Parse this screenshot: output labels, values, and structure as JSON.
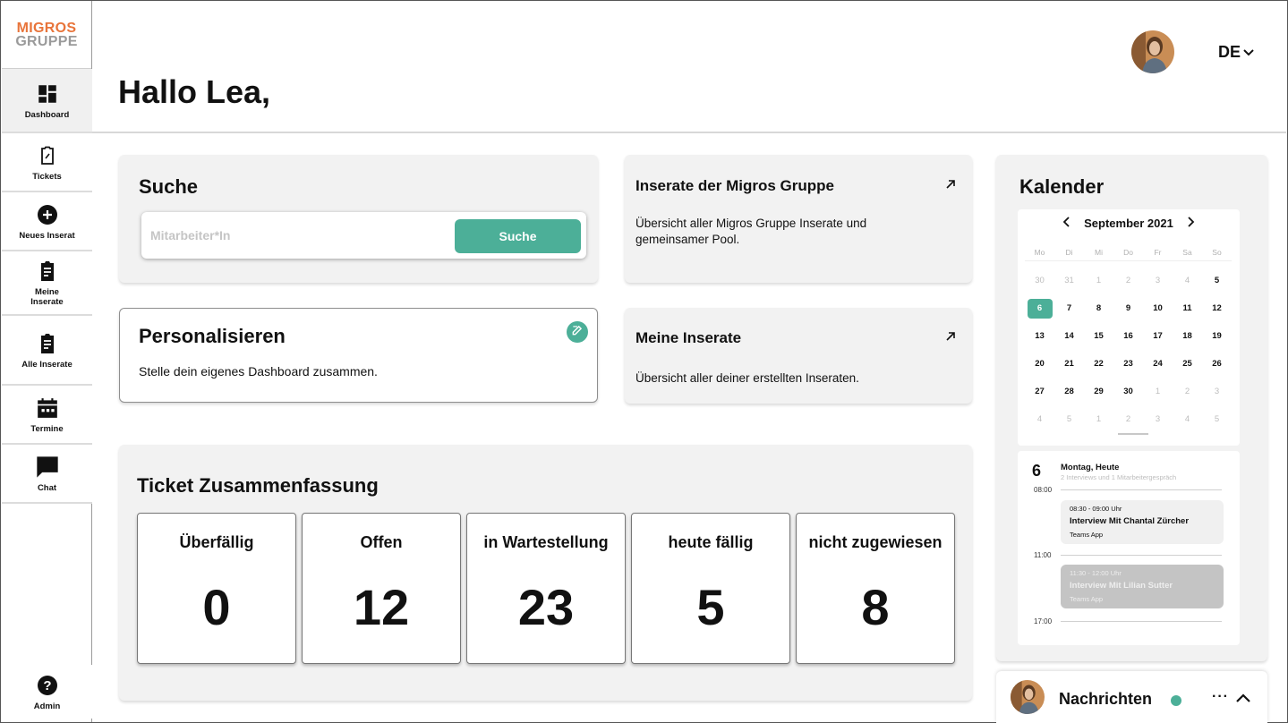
{
  "logo": {
    "line1": "MIGROS",
    "line2": "GRUPPE"
  },
  "sidebar": {
    "items": [
      {
        "label": "Dashboard",
        "icon": "dashboard-icon"
      },
      {
        "label": "Tickets",
        "icon": "ticket-clipboard-icon"
      },
      {
        "label": "Neues Inserat",
        "icon": "plus-circle-icon"
      },
      {
        "label": "Meine Inserate",
        "icon": "clipboard-list-icon"
      },
      {
        "label": "Alle Inserate",
        "icon": "clipboard-list-icon"
      },
      {
        "label": "Termine",
        "icon": "calendar-icon"
      },
      {
        "label": "Chat",
        "icon": "chat-bubble-icon"
      },
      {
        "label": "Admin",
        "icon": "help-circle-icon"
      }
    ]
  },
  "header": {
    "greeting": "Hallo Lea,",
    "language": "DE"
  },
  "search": {
    "title": "Suche",
    "placeholder": "Mitarbeiter*In",
    "button_label": "Suche"
  },
  "personalize": {
    "title": "Personalisieren",
    "text": "Stelle dein eigenes Dashboard zusammen."
  },
  "inserate_gruppe": {
    "title": "Inserate der Migros Gruppe",
    "text": "Übersicht aller Migros Gruppe Inserate und gemeinsamer Pool."
  },
  "meine_inserate": {
    "title": "Meine Inserate",
    "text": "Übersicht aller deiner erstellten Inseraten."
  },
  "tickets": {
    "title": "Ticket Zusammenfassung",
    "cards": [
      {
        "label": "Überfällig",
        "value": "0"
      },
      {
        "label": "Offen",
        "value": "12"
      },
      {
        "label": "in Wartestellung",
        "value": "23"
      },
      {
        "label": "heute fällig",
        "value": "5"
      },
      {
        "label": "nicht zugewiesen",
        "value": "8"
      }
    ]
  },
  "calendar": {
    "title": "Kalender",
    "month": "September 2021",
    "weekdays": [
      "Mo",
      "Di",
      "Mi",
      "Do",
      "Fr",
      "Sa",
      "So"
    ],
    "selected": "6",
    "weeks": [
      [
        [
          "30",
          1
        ],
        [
          "31",
          1
        ],
        [
          "1",
          1
        ],
        [
          "2",
          1
        ],
        [
          "3",
          1
        ],
        [
          "4",
          1
        ],
        [
          "5",
          0
        ]
      ],
      [
        [
          "6",
          0
        ],
        [
          "7",
          0
        ],
        [
          "8",
          0
        ],
        [
          "9",
          0
        ],
        [
          "10",
          0
        ],
        [
          "11",
          0
        ],
        [
          "12",
          0
        ]
      ],
      [
        [
          "13",
          0
        ],
        [
          "14",
          0
        ],
        [
          "15",
          0
        ],
        [
          "16",
          0
        ],
        [
          "17",
          0
        ],
        [
          "18",
          0
        ],
        [
          "19",
          0
        ]
      ],
      [
        [
          "20",
          0
        ],
        [
          "21",
          0
        ],
        [
          "22",
          0
        ],
        [
          "23",
          0
        ],
        [
          "24",
          0
        ],
        [
          "25",
          0
        ],
        [
          "26",
          0
        ]
      ],
      [
        [
          "27",
          0
        ],
        [
          "28",
          0
        ],
        [
          "29",
          0
        ],
        [
          "30",
          0
        ],
        [
          "1",
          1
        ],
        [
          "2",
          1
        ],
        [
          "3",
          1
        ]
      ],
      [
        [
          "4",
          1
        ],
        [
          "5",
          1
        ],
        [
          "1",
          1
        ],
        [
          "2",
          1
        ],
        [
          "3",
          1
        ],
        [
          "4",
          1
        ],
        [
          "5",
          1
        ]
      ]
    ],
    "day": {
      "number": "6",
      "title": "Montag, Heute",
      "subtitle": "2 Interviews und 1 Mitarbeitergespräch",
      "hours": [
        "08:00",
        "11:00",
        "17:00"
      ],
      "events": [
        {
          "time": "08:30 - 09:00 Uhr",
          "name": "Interview Mit Chantal Zürcher",
          "app": "Teams App"
        },
        {
          "time": "11:30 - 12:00 Uhr",
          "name": "Interview Mit Lilian Sutter",
          "app": "Teams App"
        }
      ]
    }
  },
  "messages": {
    "title": "Nachrichten",
    "status_color": "#4caf98"
  },
  "colors": {
    "accent": "#4caf98",
    "brand_orange": "#e8743a",
    "card_bg": "#f2f2f2"
  }
}
